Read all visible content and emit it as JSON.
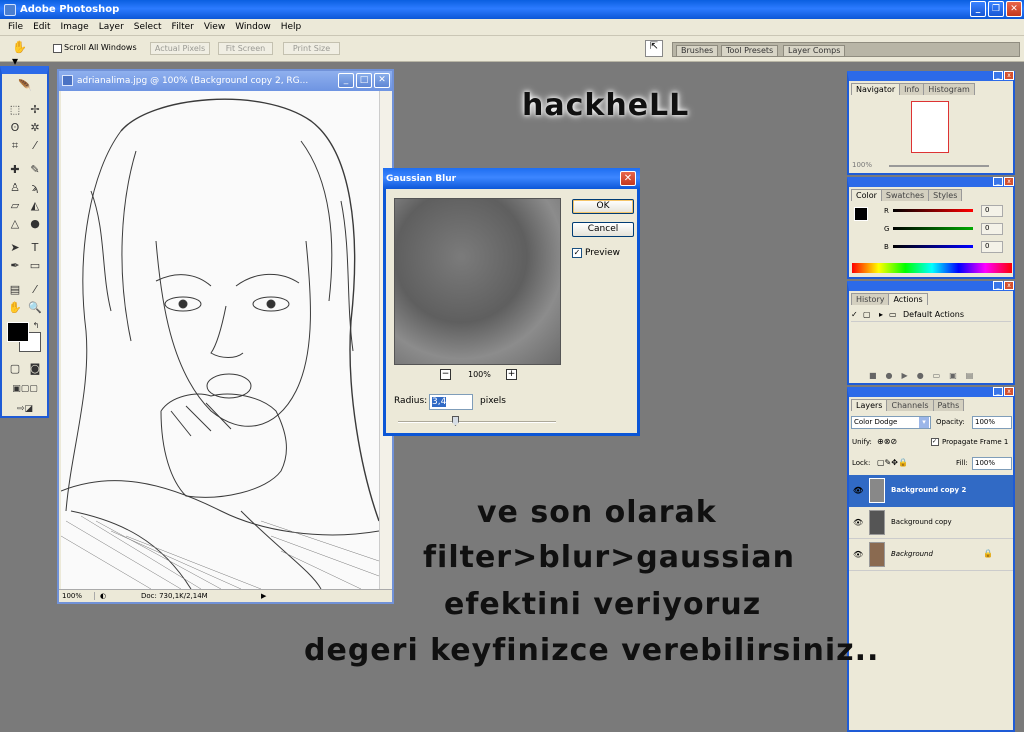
{
  "app": {
    "title": "Adobe Photoshop"
  },
  "menu": [
    "File",
    "Edit",
    "Image",
    "Layer",
    "Select",
    "Filter",
    "View",
    "Window",
    "Help"
  ],
  "options": {
    "scroll_all": "Scroll All Windows",
    "actual_pixels": "Actual Pixels",
    "fit_screen": "Fit Screen",
    "print_size": "Print Size"
  },
  "palette_well": {
    "tabs": [
      "Brushes",
      "Tool Presets",
      "Layer Comps"
    ]
  },
  "document": {
    "title": "adrianalima.jpg @ 100% (Background copy 2, RG...",
    "zoom": "100%",
    "doc_info": "Doc: 730,1K/2,14M"
  },
  "dialog": {
    "title": "Gaussian Blur",
    "ok": "OK",
    "cancel": "Cancel",
    "preview_label": "Preview",
    "preview_checked": true,
    "zoom": "100%",
    "radius_label": "Radius:",
    "radius_value": "3,4",
    "radius_unit": "pixels",
    "slider_level": 0.4
  },
  "navigator": {
    "tabs": [
      "Navigator",
      "Info",
      "Histogram"
    ],
    "zoom": "100%"
  },
  "color": {
    "tabs": [
      "Color",
      "Swatches",
      "Styles"
    ],
    "channels": [
      "R",
      "G",
      "B"
    ],
    "values": [
      "0",
      "0",
      "0"
    ]
  },
  "history": {
    "tabs": [
      "History",
      "Actions"
    ],
    "item": "Default Actions"
  },
  "layers": {
    "tabs": [
      "Layers",
      "Channels",
      "Paths"
    ],
    "blend_mode": "Color Dodge",
    "opacity_label": "Opacity:",
    "opacity": "100%",
    "unify_label": "Unify:",
    "propagate": "Propagate Frame 1",
    "lock_label": "Lock:",
    "fill_label": "Fill:",
    "fill": "100%",
    "items": [
      {
        "name": "Background copy 2",
        "selected": true
      },
      {
        "name": "Background copy",
        "selected": false
      },
      {
        "name": "Background",
        "selected": false
      }
    ]
  },
  "overlay": {
    "signature": "hackheLL",
    "lines": [
      "ve son olarak",
      "filter>blur>gaussian",
      "efektini veriyoruz",
      "degeri keyfinizce verebilirsiniz.."
    ]
  },
  "colors": {
    "title_blue": "#0b56d6",
    "selection": "#316ac5"
  }
}
